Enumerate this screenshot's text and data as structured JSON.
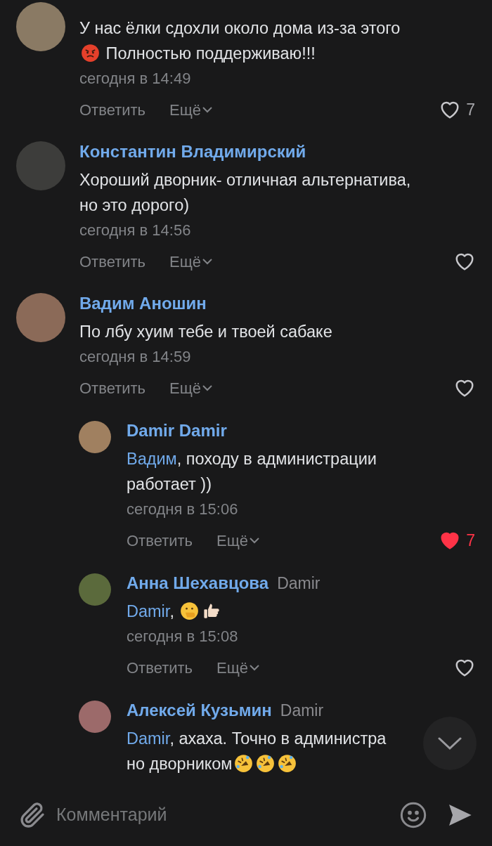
{
  "comments": [
    {
      "body": [
        {
          "kind": "text",
          "text": "У нас ёлки сдохли около дома из-за этого"
        },
        {
          "kind": "break"
        },
        {
          "kind": "emoji-angry"
        },
        {
          "kind": "text",
          "text": " Полностью поддерживаю!!!"
        }
      ],
      "time": "сегодня в 14:49",
      "reply_label": "Ответить",
      "more_label": "Ещё",
      "liked": false,
      "like_count": "7"
    },
    {
      "author": "Константин Владимирский",
      "body": [
        {
          "kind": "text",
          "text": "Хороший дворник- отличная альтернатива,"
        },
        {
          "kind": "break"
        },
        {
          "kind": "text",
          "text": "но это дорого)"
        }
      ],
      "time": "сегодня в 14:56",
      "reply_label": "Ответить",
      "more_label": "Ещё",
      "liked": false
    },
    {
      "author": "Вадим Аношин",
      "body": [
        {
          "kind": "text",
          "text": "По лбу хуим тебе и твоей сабаке"
        }
      ],
      "time": "сегодня в 14:59",
      "reply_label": "Ответить",
      "more_label": "Ещё",
      "liked": false,
      "replies": [
        {
          "author": "Damir Damir",
          "body": [
            {
              "kind": "mention",
              "text": "Вадим"
            },
            {
              "kind": "text",
              "text": ", походу в администрации"
            },
            {
              "kind": "break"
            },
            {
              "kind": "text",
              "text": "работает ))"
            }
          ],
          "time": "сегодня в 15:06",
          "reply_label": "Ответить",
          "more_label": "Ещё",
          "liked": true,
          "like_count": "7"
        },
        {
          "author": "Анна Шехавцова",
          "reply_to": "Damir",
          "body": [
            {
              "kind": "mention",
              "text": "Damir"
            },
            {
              "kind": "text",
              "text": ", "
            },
            {
              "kind": "emoji-shush"
            },
            {
              "kind": "emoji-thumbs"
            }
          ],
          "time": "сегодня в 15:08",
          "reply_label": "Ответить",
          "more_label": "Ещё",
          "liked": false
        },
        {
          "author": "Алексей Кузьмин",
          "reply_to": "Damir",
          "body": [
            {
              "kind": "mention",
              "text": "Damir"
            },
            {
              "kind": "text",
              "text": ", ахаха. Точно в администра"
            },
            {
              "kind": "break"
            },
            {
              "kind": "text",
              "text": "но дворником"
            },
            {
              "kind": "emoji-rofl"
            },
            {
              "kind": "emoji-rofl"
            },
            {
              "kind": "emoji-rofl"
            }
          ]
        }
      ]
    }
  ],
  "composer": {
    "placeholder": "Комментарий"
  }
}
